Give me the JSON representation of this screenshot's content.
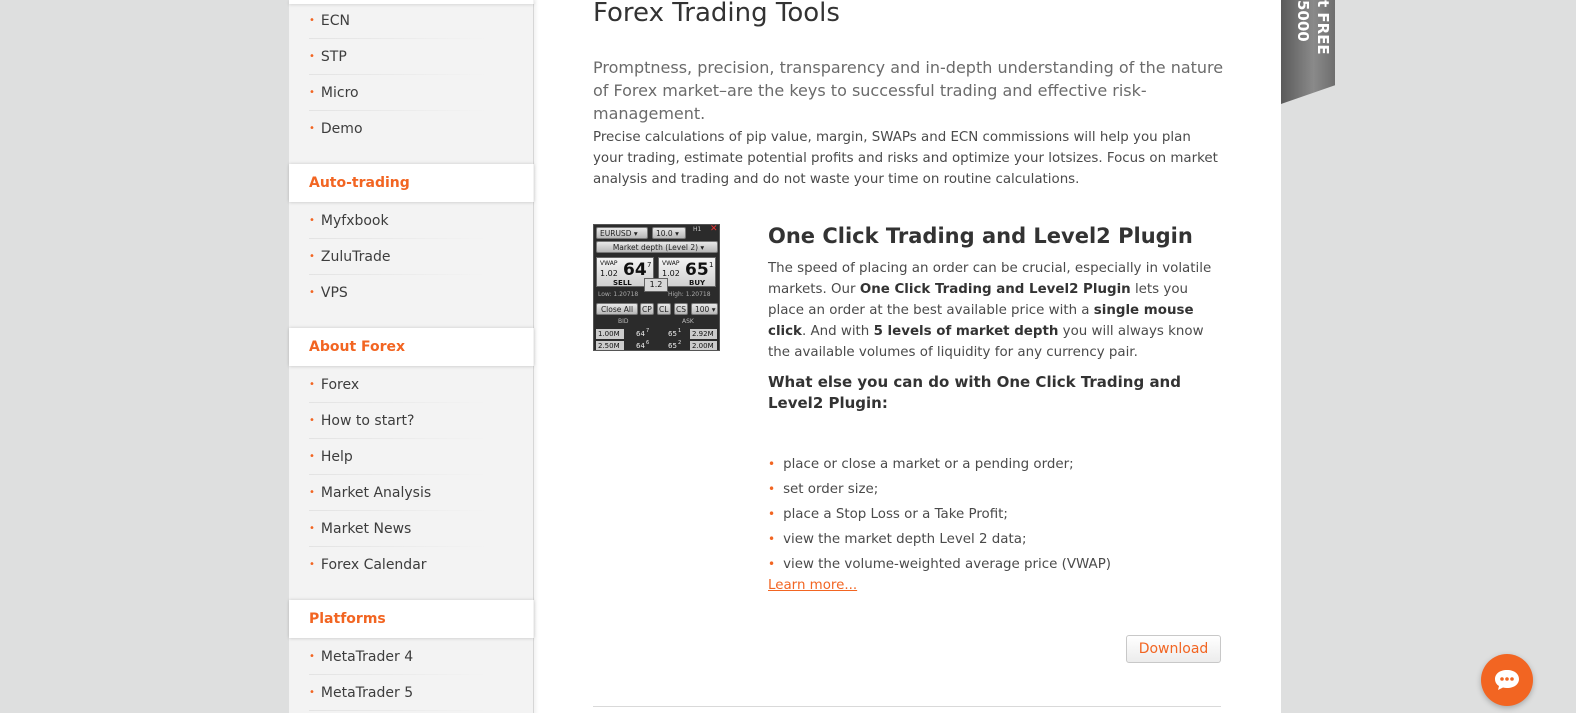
{
  "sidebar": {
    "top_items": [
      {
        "label": "ECN"
      },
      {
        "label": "STP"
      },
      {
        "label": "Micro"
      },
      {
        "label": "Demo"
      }
    ],
    "sections": [
      {
        "heading": "Auto-trading",
        "items": [
          {
            "label": "Myfxbook"
          },
          {
            "label": "ZuluTrade"
          },
          {
            "label": "VPS"
          }
        ]
      },
      {
        "heading": "About Forex",
        "items": [
          {
            "label": "Forex"
          },
          {
            "label": "How to start?"
          },
          {
            "label": "Help"
          },
          {
            "label": "Market Analysis"
          },
          {
            "label": "Market News"
          },
          {
            "label": "Forex Calendar"
          }
        ]
      },
      {
        "heading": "Platforms",
        "items": [
          {
            "label": "MetaTrader 4"
          },
          {
            "label": "MetaTrader 5"
          }
        ]
      }
    ]
  },
  "main": {
    "title": "Forex Trading Tools",
    "lead": "Promptness, precision, transparency and in-depth understanding of the nature of Forex market–are the keys to successful trading and effective risk-management.",
    "body": "Precise calculations of pip value, margin, SWAPs  and ECN  commissions will help you plan your trading, estimate potential profits and risks and optimize your lotsizes. Focus on market analysis and trading and do not waste your time on routine calculations.",
    "plugin": {
      "title": "One Click Trading and Level2 Plugin",
      "desc_parts": {
        "p1": "The speed of placing an order can be crucial, especially in volatile markets. Our ",
        "b1": "One Click Trading and Level2 Plugin",
        "p2": " lets you place an order at the best available price with a ",
        "b2": "single mouse click",
        "p3": ". And with ",
        "b3": "5 levels of market depth",
        "p4": " you will always know the available volumes of liquidity for any currency pair."
      },
      "what_else": "What else you can do with One Click Trading and Level2 Plugin:",
      "features": [
        "place or close a market or a pending order;",
        "set order size;",
        "place a Stop Loss or a Take Profit;",
        "view the market depth Level 2 data;",
        "view the volume-weighted average price (VWAP)"
      ],
      "learn_more": "Learn more...",
      "download": "Download"
    },
    "thumbnail": {
      "symbol": "EURUSD",
      "lot": "10.0",
      "timeframe": "H1",
      "depth_label": "Market depth (Level 2)",
      "sell": {
        "tag": "VWAP",
        "prefix": "1.02",
        "pips": "64",
        "frac": "7",
        "label": "SELL"
      },
      "buy": {
        "tag": "VWAP",
        "prefix": "1.02",
        "pips": "65",
        "frac": "1",
        "label": "BUY"
      },
      "spread": "1.2",
      "low": "Low:  1.20718",
      "high": "High:  1.20718",
      "close_all": "Close All",
      "btn_cp": "CP",
      "btn_cl": "CL",
      "btn_cs": "CS",
      "qty": "100",
      "bid": "BID",
      "ask": "ASK",
      "rows": [
        {
          "bid_vol": "1.00M",
          "bid": "64",
          "bid_f": "7",
          "ask": "65",
          "ask_f": "1",
          "ask_vol": "2.92M"
        },
        {
          "bid_vol": "2.50M",
          "bid": "64",
          "bid_f": "6",
          "ask": "65",
          "ask_f": "2",
          "ask_vol": "2.00M"
        }
      ]
    }
  },
  "ribbon": {
    "text": "t FREE 5000"
  },
  "colors": {
    "accent": "#f26522",
    "background": "#dedfdf",
    "sidebar": "#f3f3f3"
  }
}
